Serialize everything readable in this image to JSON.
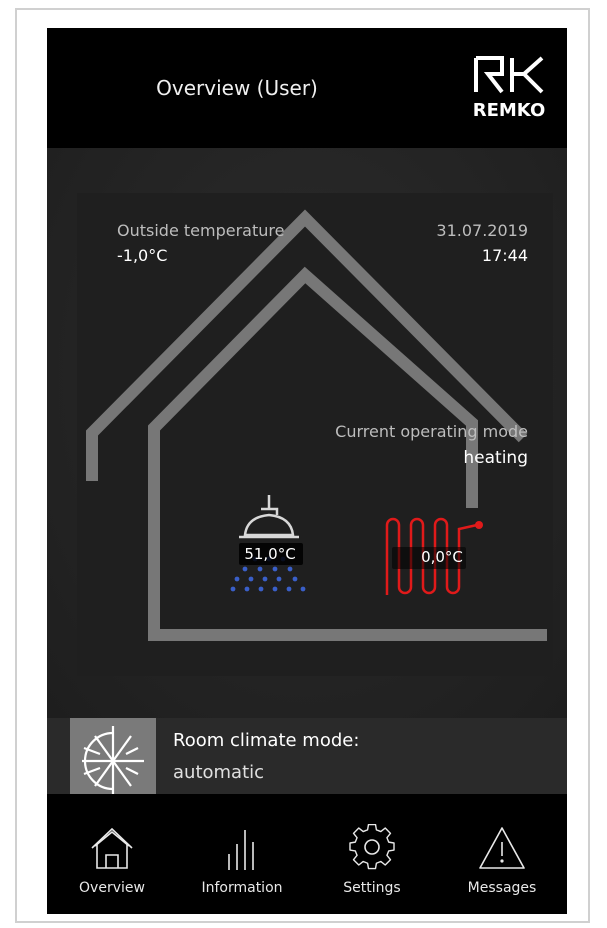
{
  "header": {
    "title": "Overview (User)",
    "logo_text": "REMKO"
  },
  "status": {
    "outside_temperature_label": "Outside temperature",
    "outside_temperature_value": "-1,0°C",
    "date": "31.07.2019",
    "time": "17:44",
    "operating_mode_label": "Current operating mode",
    "operating_mode_value": "heating"
  },
  "hot_water": {
    "icon": "shower-icon",
    "temperature": "51,0°C"
  },
  "heating_circuit": {
    "icon": "underfloor-heating-icon",
    "temperature": "0,0°C"
  },
  "room_climate": {
    "icon": "sun-snowflake-icon",
    "label": "Room climate mode:",
    "value": "automatic"
  },
  "nav": {
    "items": [
      {
        "label": "Overview",
        "icon": "house-icon"
      },
      {
        "label": "Information",
        "icon": "bars-icon"
      },
      {
        "label": "Settings",
        "icon": "gear-icon"
      },
      {
        "label": "Messages",
        "icon": "warning-icon"
      }
    ]
  },
  "colors": {
    "background": "#2a2a2a",
    "house": "#777777",
    "water_drops": "#3a5fc8",
    "heating_coil": "#e01a1a",
    "header": "#000000"
  }
}
